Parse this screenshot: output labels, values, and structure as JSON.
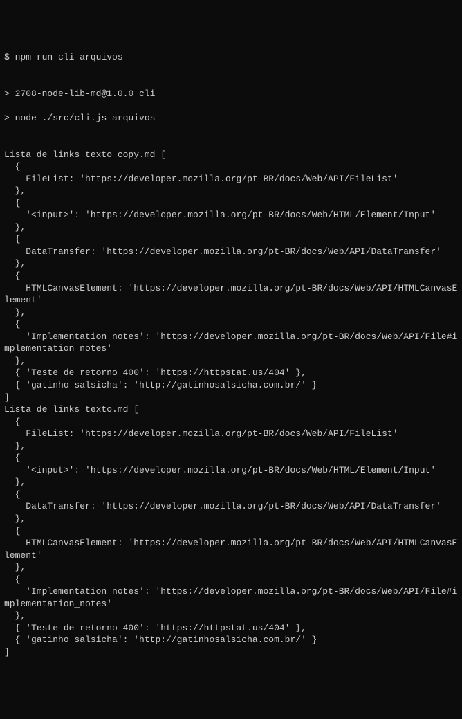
{
  "command": {
    "prompt": "$",
    "text": "npm run cli arquivos"
  },
  "header": {
    "line1_prefix": ">",
    "line1_text": "2708-node-lib-md@1.0.0 cli",
    "line2_prefix": ">",
    "line2_text": "node ./src/cli.js arquivos"
  },
  "output_lines": [
    "Lista de links texto copy.md [",
    "  {",
    "    FileList: 'https://developer.mozilla.org/pt-BR/docs/Web/API/FileList'",
    "  },",
    "  {",
    "    '<input>': 'https://developer.mozilla.org/pt-BR/docs/Web/HTML/Element/Input'",
    "  },",
    "  {",
    "    DataTransfer: 'https://developer.mozilla.org/pt-BR/docs/Web/API/DataTransfer'",
    "  },",
    "  {",
    "    HTMLCanvasElement: 'https://developer.mozilla.org/pt-BR/docs/Web/API/HTMLCanvasElement'",
    "  },",
    "  {",
    "    'Implementation notes': 'https://developer.mozilla.org/pt-BR/docs/Web/API/File#implementation_notes'",
    "  },",
    "  { 'Teste de retorno 400': 'https://httpstat.us/404' },",
    "  { 'gatinho salsicha': 'http://gatinhosalsicha.com.br/' }",
    "]",
    "Lista de links texto.md [",
    "  {",
    "    FileList: 'https://developer.mozilla.org/pt-BR/docs/Web/API/FileList'",
    "  },",
    "  {",
    "    '<input>': 'https://developer.mozilla.org/pt-BR/docs/Web/HTML/Element/Input'",
    "  },",
    "  {",
    "    DataTransfer: 'https://developer.mozilla.org/pt-BR/docs/Web/API/DataTransfer'",
    "  },",
    "  {",
    "    HTMLCanvasElement: 'https://developer.mozilla.org/pt-BR/docs/Web/API/HTMLCanvasElement'",
    "  },",
    "  {",
    "    'Implementation notes': 'https://developer.mozilla.org/pt-BR/docs/Web/API/File#implementation_notes'",
    "  },",
    "  { 'Teste de retorno 400': 'https://httpstat.us/404' },",
    "  { 'gatinho salsicha': 'http://gatinhosalsicha.com.br/' }",
    "]"
  ]
}
